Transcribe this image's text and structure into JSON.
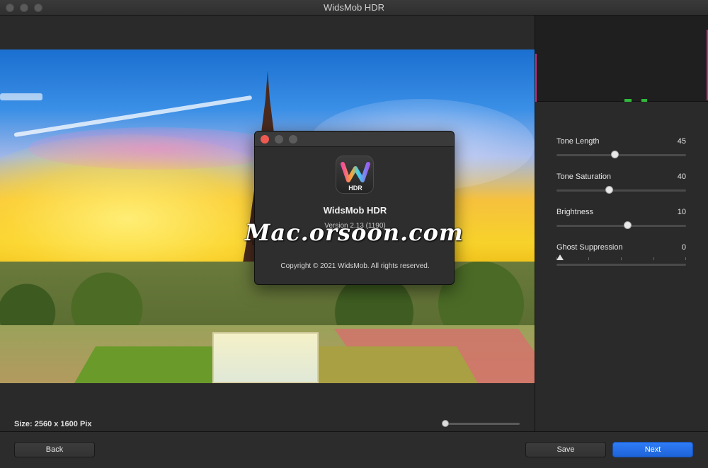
{
  "window": {
    "title": "WidsMob HDR"
  },
  "canvas": {
    "size_label": "Size: 2560 x 1600 Pix",
    "zoom_level": 0.0
  },
  "adjustments": [
    {
      "label": "Tone Length",
      "value": "45",
      "level": 0.45
    },
    {
      "label": "Tone Saturation",
      "value": "40",
      "level": 0.4
    },
    {
      "label": "Brightness",
      "value": "10",
      "level": 0.55
    },
    {
      "label": "Ghost Suppression",
      "value": "0",
      "level": 0.0
    }
  ],
  "buttons": {
    "back": "Back",
    "save": "Save",
    "next": "Next"
  },
  "about": {
    "icon_text": "HDR",
    "app_name": "WidsMob HDR",
    "version": "Version 2.13 (1190)",
    "copyright": "Copyright © 2021 WidsMob. All rights reserved."
  },
  "watermark": "Mac.orsoon.com",
  "colors": {
    "primary_button": "#1e63d8",
    "close_red": "#ee5a52"
  }
}
